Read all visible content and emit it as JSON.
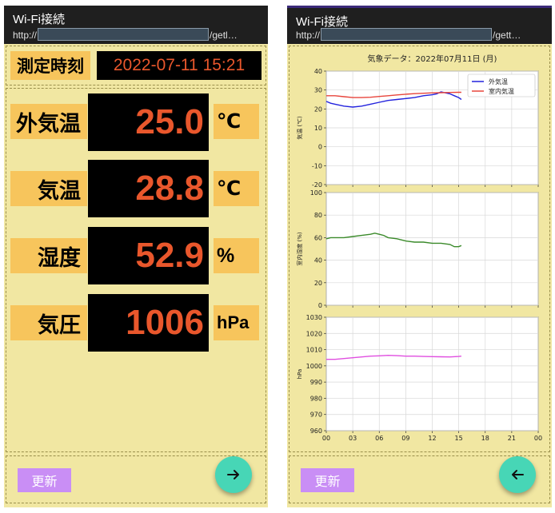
{
  "left": {
    "app_title": "Wi-Fi接続",
    "url_prefix": "http://",
    "url_suffix": "/getl…",
    "measure_label": "測定時刻",
    "measure_time": "2022-07-11 15:21",
    "readings": [
      {
        "label": "外気温",
        "value": "25.0",
        "unit": "℃"
      },
      {
        "label": "気温",
        "value": "28.8",
        "unit": "℃"
      },
      {
        "label": "湿度",
        "value": "52.9",
        "unit": "%"
      },
      {
        "label": "気圧",
        "value": "1006",
        "unit": "hPa"
      }
    ],
    "update_button": "更新",
    "fab_icon": "arrow-right-icon"
  },
  "right": {
    "app_title": "Wi-Fi接続",
    "url_prefix": "http://",
    "url_suffix": "/gett…",
    "update_button": "更新",
    "fab_icon": "arrow-left-icon"
  },
  "colors": {
    "outside_temp": "#2222dd",
    "indoor_temp": "#e8453c",
    "humidity": "#3a8a2a",
    "pressure": "#e04ee0",
    "fab": "#47d6b6",
    "label_bg": "#f7c55c",
    "value_text": "#e9572c"
  },
  "chart_data": [
    {
      "type": "line",
      "title": "気象データ：2022年07月11日 (月)",
      "ylabel": "気温 (℃)",
      "ylim": [
        -20,
        40
      ],
      "yticks": [
        40,
        30,
        20,
        10,
        0,
        -10,
        -20
      ],
      "xlim": [
        0,
        24
      ],
      "grid": true,
      "legend": "top-right",
      "series": [
        {
          "name": "外気温",
          "color": "#2222dd",
          "x": [
            0,
            0.5,
            1,
            2,
            3,
            4,
            5,
            6,
            7,
            8,
            9,
            10,
            11,
            12,
            12.5,
            13,
            13.5,
            14,
            14.5,
            15,
            15.3
          ],
          "y": [
            24,
            23,
            22.5,
            21.5,
            21,
            21.5,
            22.5,
            23.5,
            24.5,
            25,
            25.5,
            26,
            27,
            27.5,
            28,
            29,
            28.5,
            28,
            27,
            26,
            25
          ]
        },
        {
          "name": "室内気温",
          "color": "#e8453c",
          "x": [
            0,
            1,
            2,
            3,
            4,
            5,
            6,
            7,
            8,
            9,
            10,
            11,
            12,
            13,
            14,
            15,
            15.3
          ],
          "y": [
            27,
            27,
            26.5,
            26,
            26,
            26.2,
            26.6,
            27,
            27.4,
            27.8,
            28.1,
            28.3,
            28.5,
            28.6,
            28.7,
            28.8,
            28.8
          ]
        }
      ]
    },
    {
      "type": "line",
      "ylabel": "室内湿度 (%)",
      "ylim": [
        0,
        100
      ],
      "yticks": [
        100,
        80,
        60,
        40,
        20,
        0
      ],
      "xlim": [
        0,
        24
      ],
      "grid": true,
      "series": [
        {
          "color": "#3a8a2a",
          "x": [
            0,
            0.5,
            1,
            2,
            3,
            4,
            5,
            5.5,
            6,
            6.5,
            7,
            8,
            9,
            10,
            11,
            12,
            13,
            14,
            14.5,
            15,
            15.3
          ],
          "y": [
            59,
            60,
            60,
            60,
            61,
            62,
            63,
            64,
            63,
            62,
            60,
            59,
            57,
            56,
            56,
            55,
            55,
            54,
            52,
            52,
            53
          ]
        }
      ]
    },
    {
      "type": "line",
      "ylabel": "hPa",
      "ylim": [
        960,
        1030
      ],
      "yticks": [
        1030,
        1020,
        1010,
        1000,
        990,
        980,
        970,
        960
      ],
      "xlim": [
        0,
        24
      ],
      "xticks": [
        "00",
        "03",
        "06",
        "09",
        "12",
        "15",
        "18",
        "21",
        "00"
      ],
      "grid": true,
      "series": [
        {
          "color": "#e04ee0",
          "x": [
            0,
            1,
            2,
            3,
            4,
            5,
            6,
            7,
            8,
            9,
            10,
            11,
            12,
            13,
            14,
            15,
            15.3
          ],
          "y": [
            1004,
            1004,
            1004.5,
            1005,
            1005.5,
            1006,
            1006.2,
            1006.5,
            1006.3,
            1006,
            1006,
            1005.8,
            1005.7,
            1005.6,
            1005.5,
            1005.8,
            1006
          ]
        }
      ]
    }
  ]
}
